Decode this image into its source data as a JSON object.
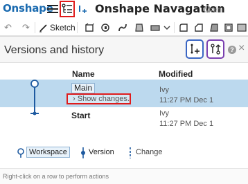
{
  "app": {
    "brand": "Onshape",
    "document_title": "Onshape Navagation",
    "workspace_name": "Main"
  },
  "toolbar": {
    "sketch_label": "Sketch"
  },
  "panel": {
    "title": "Versions and history",
    "columns": {
      "name": "Name",
      "modified": "Modified"
    },
    "rows": [
      {
        "name": "Main",
        "show_changes": "Show changes...",
        "user": "Ivy",
        "time": "11:27 PM Dec 1"
      },
      {
        "name": "Start",
        "user": "Ivy",
        "time": "11:27 PM Dec 1"
      }
    ],
    "legend": {
      "workspace": "Workspace",
      "version": "Version",
      "change": "Change"
    },
    "footer_hint": "Right-click on a row to perform actions",
    "help_glyph": "?",
    "close_glyph": "×"
  },
  "colors": {
    "brand_blue": "#1b6bb0",
    "selected_row": "#bcd9ee",
    "highlight_red": "#e01b1b",
    "highlight_blue": "#3a66c4",
    "highlight_purple": "#7a3fb0"
  }
}
